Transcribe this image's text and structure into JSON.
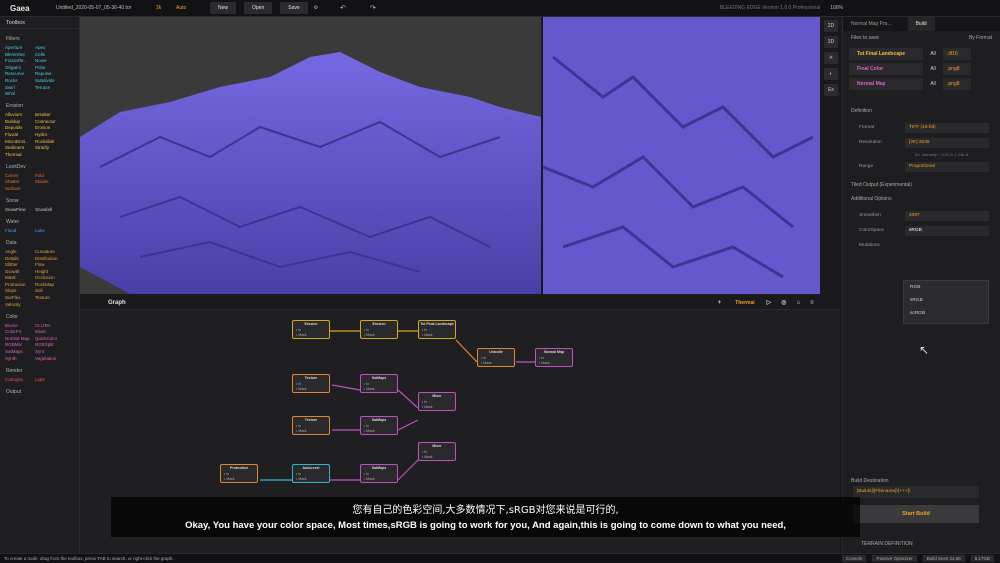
{
  "topbar": {
    "app": "Gaea",
    "file": "Untitled_2020-05-07_05-36-40.tor",
    "res": "2k",
    "mode": "Auto",
    "new": "New",
    "open": "Open",
    "save": "Save",
    "edition": "BLEEDING EDGE Version 1.0.0 Professional",
    "zoom": "100%"
  },
  "toolbox": {
    "title": "Toolbox",
    "categories": [
      {
        "name": "Filters",
        "items": [
          [
            "Aperture",
            "Apex"
          ],
          [
            "Blemisher",
            "Cells"
          ],
          [
            "FractalTe..",
            "Noise"
          ],
          [
            "Origami",
            "Polar"
          ],
          [
            "Rescurve",
            "Repulse"
          ],
          [
            "Rocks",
            "Subdivide"
          ],
          [
            "Swirl",
            "Terrace"
          ],
          [
            "Whirl",
            ""
          ]
        ]
      },
      {
        "name": "Erosion",
        "items": [
          [
            "Alluvium",
            "Breaker"
          ],
          [
            "Buildup",
            "Connector"
          ],
          [
            "Deposits",
            "Erosion"
          ],
          [
            "Fluvial",
            "Hydro"
          ],
          [
            "MicroEros..",
            "Rockslide"
          ],
          [
            "Sediment",
            "Stratify"
          ],
          [
            "Thermal",
            ""
          ]
        ]
      },
      {
        "name": "LookDev",
        "items": [
          [
            "Carver",
            "Fold"
          ],
          [
            "Shatter",
            "Stacks"
          ],
          [
            "Surface",
            ""
          ]
        ]
      },
      {
        "name": "Snow",
        "items": [
          [
            "SnowFlow",
            "Snowfall"
          ]
        ]
      },
      {
        "name": "Water",
        "items": [
          [
            "Flood",
            "Lake"
          ]
        ]
      },
      {
        "name": "Data",
        "items": [
          [
            "Angle",
            "Curvature"
          ],
          [
            "Details",
            "Distribution"
          ],
          [
            "Slittter",
            "Flow"
          ],
          [
            "Growth",
            "Height"
          ],
          [
            "Mask",
            "Occlusion"
          ],
          [
            "Protrusion",
            "RockMap"
          ],
          [
            "Slope",
            "Soil"
          ],
          [
            "SurFlex",
            "Texture"
          ],
          [
            "Velocity",
            ""
          ]
        ]
      },
      {
        "name": "Color",
        "items": [
          [
            "Biome",
            "CLUTer"
          ],
          [
            "ColorFX",
            "Mixer"
          ],
          [
            "Normal Map",
            "QuickColor"
          ],
          [
            "RGBMix",
            "RGBSplit"
          ],
          [
            "SatMaps",
            "Synt"
          ],
          [
            "Synth",
            "Vegetation"
          ]
        ]
      },
      {
        "name": "Render",
        "items": [
          [
            "Cartogra..",
            "Light"
          ]
        ]
      },
      {
        "name": "Output",
        "items": []
      }
    ]
  },
  "viewport_tools": [
    "2D",
    "3D",
    "Ex"
  ],
  "graph": {
    "title": "Graph",
    "mode": "Thermal",
    "nodes": [
      {
        "title": "Erosion",
        "color": "y"
      },
      {
        "title": "Erosion",
        "color": "y"
      },
      {
        "title": "Tut Final Landscape",
        "color": "y"
      },
      {
        "title": "Unicolle",
        "color": "or"
      },
      {
        "title": "Normal Map",
        "color": "pk"
      },
      {
        "title": "Texture",
        "color": "or"
      },
      {
        "title": "SatMaps",
        "color": "pk"
      },
      {
        "title": "Mixer",
        "color": "pk"
      },
      {
        "title": "Texture",
        "color": "or"
      },
      {
        "title": "SatMaps",
        "color": "pk"
      },
      {
        "title": "Mixer",
        "color": "pk"
      },
      {
        "title": "Protrudion",
        "color": "or"
      },
      {
        "title": "AutoLevel",
        "color": "cy"
      },
      {
        "title": "SatMaps",
        "color": "pk"
      }
    ]
  },
  "panel": {
    "tabs": [
      "Normal Map Pro...",
      "Build"
    ],
    "files_header": "Files to save",
    "by_format": "By Format",
    "files": [
      {
        "label": "Tut Final Landscape",
        "all": "All",
        "ext": ".tif16"
      },
      {
        "label": "Final Color",
        "all": "All",
        "ext": ".png8"
      },
      {
        "label": "Normal Map",
        "all": "All",
        "ext": ".png8"
      }
    ],
    "definition": "Definition",
    "format_label": "Format",
    "format_value": "TIFF (16-bit)",
    "resolution_label": "Resolution",
    "resolution_value": "[2K] 2048",
    "resolution_note": "Ex. Intensity ~ 0.01 in 1.24k-8",
    "range_label": "Range",
    "range_value": "Proportional",
    "tiled": "Tiled Output (Experimental)",
    "additional": "Additional Options",
    "smoothing_label": "Smoothen",
    "smoothing_value": "4097",
    "colorspace_label": "ColorSpace",
    "colorspace_value": "sRGB",
    "mutations_label": "Mutations",
    "options": [
      "RGB",
      "sRGB",
      "scRGB"
    ],
    "build_dest": "Build Destination",
    "dest_value": "[Builds]\\[Filename]\\[+++]\\",
    "start_build": "Start Build",
    "terrain_def": "TERRAIN DEFINITION"
  },
  "subtitle": {
    "zh": "您有自己的色彩空间,大多数情况下,sRGB对您来说是可行的,",
    "en": "Okay, You have your color space, Most times,sRGB is going to work for you, And again,this is going to come down to what you need,"
  },
  "statusbar": {
    "hint": "To create a node: drag from the toolbox, press TAB to search, or right-click the graph.",
    "console": "Console",
    "passive": "Passive Optimizer",
    "build": "Build Sees 24.56",
    "mem": "5.17GB"
  }
}
